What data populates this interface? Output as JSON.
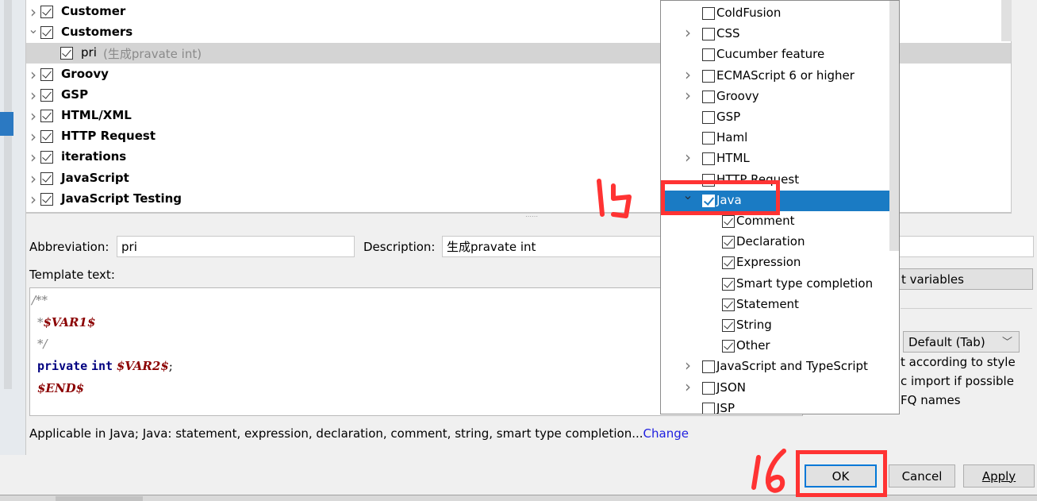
{
  "tree": {
    "items": [
      {
        "label": "Customer",
        "checked": true,
        "expanded": false,
        "bold": true
      },
      {
        "label": "Customers",
        "checked": true,
        "expanded": true,
        "bold": true
      },
      {
        "label": "pri",
        "desc": "(生成pravate int)",
        "checked": true,
        "child": true,
        "selected": true
      },
      {
        "label": "Groovy",
        "checked": true,
        "expanded": false,
        "bold": true
      },
      {
        "label": "GSP",
        "checked": true,
        "expanded": false,
        "bold": true
      },
      {
        "label": "HTML/XML",
        "checked": true,
        "expanded": false,
        "bold": true
      },
      {
        "label": "HTTP Request",
        "checked": true,
        "expanded": false,
        "bold": true
      },
      {
        "label": "iterations",
        "checked": true,
        "expanded": false,
        "bold": true
      },
      {
        "label": "JavaScript",
        "checked": true,
        "expanded": false,
        "bold": true
      },
      {
        "label": "JavaScript Testing",
        "checked": true,
        "expanded": false,
        "bold": true
      }
    ]
  },
  "form": {
    "abbreviation_label": "Abbreviation:",
    "abbreviation_value": "pri",
    "description_label": "Description:",
    "description_value": "生成pravate int",
    "template_label": "Template text:",
    "code": {
      "l1": "/**",
      "l2_prefix": "*",
      "l2_var": "$VAR1$",
      "l3": "*/",
      "l4_kw1": "private",
      "l4_kw2": "int",
      "l4_var": "$VAR2$",
      "l4_end": ";",
      "l5_var": "$END$"
    },
    "applicable_text": "Applicable in Java; Java: statement, expression, declaration, comment, string, smart type completion...",
    "change_link": "Change"
  },
  "options": {
    "edit_variables": "t variables",
    "expand_with_value": "Default (Tab)",
    "reformat": "t according to style",
    "static_import": "c import if possible",
    "shorten_fq": "FQ names"
  },
  "popup": {
    "items": [
      {
        "label": "ColdFusion",
        "checked": false,
        "expandable": false
      },
      {
        "label": "CSS",
        "checked": false,
        "expandable": true
      },
      {
        "label": "Cucumber feature",
        "checked": false,
        "expandable": false
      },
      {
        "label": "ECMAScript 6 or higher",
        "checked": false,
        "expandable": true
      },
      {
        "label": "Groovy",
        "checked": false,
        "expandable": true
      },
      {
        "label": "GSP",
        "checked": false,
        "expandable": false
      },
      {
        "label": "Haml",
        "checked": false,
        "expandable": false
      },
      {
        "label": "HTML",
        "checked": false,
        "expandable": true
      },
      {
        "label": "HTTP Request",
        "checked": false,
        "expandable": false
      },
      {
        "label": "Java",
        "checked": true,
        "expandable": true,
        "expanded": true,
        "selected": true
      },
      {
        "label": "Comment",
        "checked": true,
        "child": true
      },
      {
        "label": "Declaration",
        "checked": true,
        "child": true
      },
      {
        "label": "Expression",
        "checked": true,
        "child": true
      },
      {
        "label": "Smart type completion",
        "checked": true,
        "child": true
      },
      {
        "label": "Statement",
        "checked": true,
        "child": true
      },
      {
        "label": "String",
        "checked": true,
        "child": true
      },
      {
        "label": "Other",
        "checked": true,
        "child": true
      },
      {
        "label": "JavaScript and TypeScript",
        "checked": false,
        "expandable": true
      },
      {
        "label": "JSON",
        "checked": false,
        "expandable": true
      },
      {
        "label": "JSP",
        "checked": false,
        "expandable": false
      }
    ]
  },
  "buttons": {
    "ok": "OK",
    "cancel": "Cancel",
    "apply": "Apply"
  },
  "annotations": {
    "step1": "15",
    "step2": "16",
    "highlight_color": "#ff3333"
  },
  "colors": {
    "selection": "#1a7bc4",
    "link": "#2020e0",
    "variable": "#8b0000",
    "keyword": "#000080"
  }
}
